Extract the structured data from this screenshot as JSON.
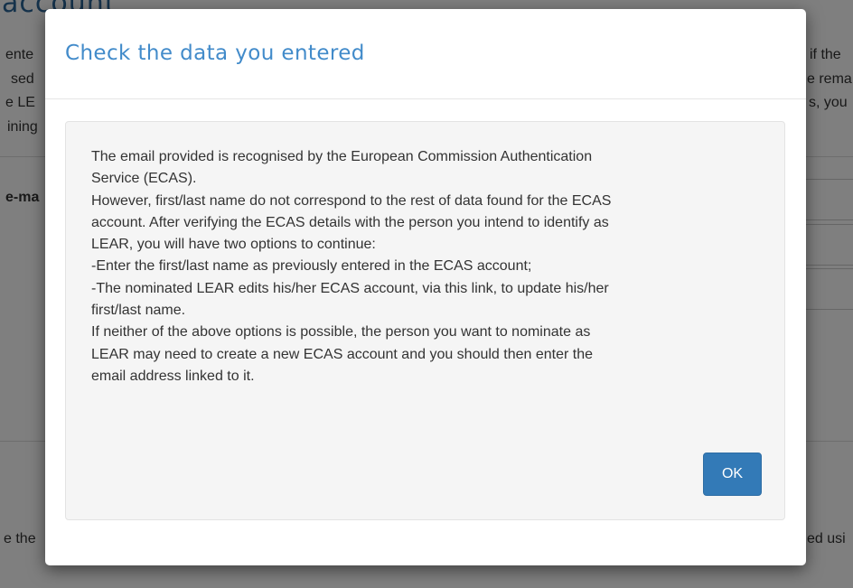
{
  "background": {
    "heading": "account",
    "left_fragments": [
      "ente",
      "sed",
      "e LE",
      "ining",
      "e-ma",
      "e the"
    ],
    "right_fragments": [
      "if the",
      "e rema",
      "s, you",
      "ed usi"
    ]
  },
  "dialog": {
    "title": "Check the data you entered",
    "message_lines": [
      "The email provided is recognised by the European Commission Authentication",
      "Service (ECAS).",
      "However, first/last name do not correspond to the rest of data found for the ECAS",
      "account. After verifying the ECAS details with the person you intend to identify as",
      "LEAR, you will have two options to continue:",
      "-Enter the first/last name as previously entered in the ECAS account;",
      "-The nominated LEAR edits his/her ECAS account, via this link, to update his/her",
      "first/last name.",
      "If neither of the above options is possible, the person you want to nominate as",
      "LEAR may need to create a new ECAS account and you should then enter the",
      "email address linked to it."
    ],
    "ok_label": "OK",
    "colors": {
      "title": "#428bca",
      "button": "#337ab7",
      "well": "#f5f5f5"
    }
  }
}
